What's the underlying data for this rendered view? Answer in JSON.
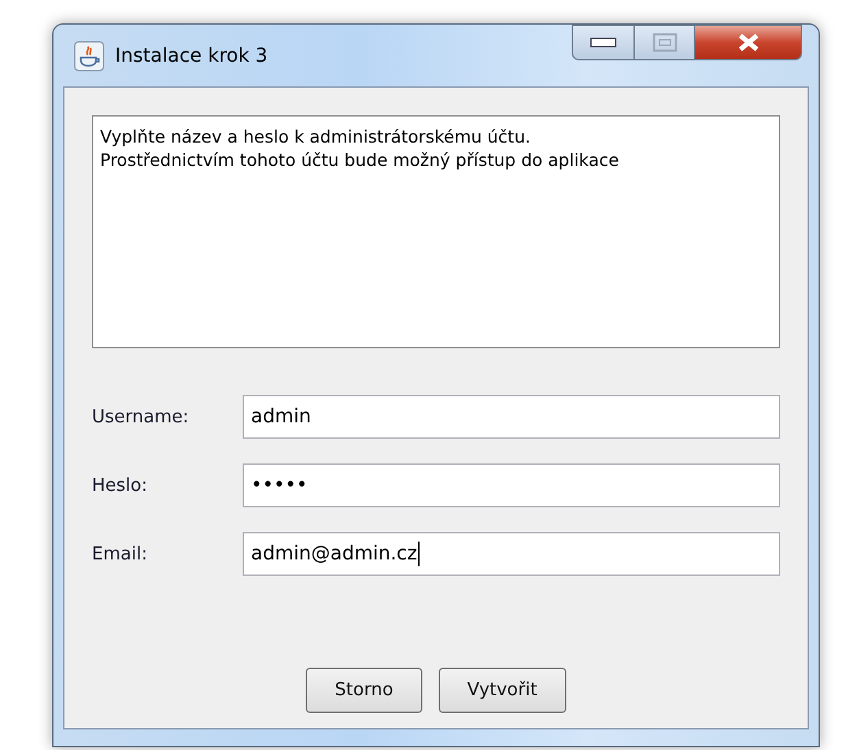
{
  "window": {
    "title": "Instalace krok 3"
  },
  "description": {
    "lines": [
      "Vyplňte název a heslo k administrátorskému účtu.",
      "Prostřednictvím tohoto účtu bude možný přístup do aplikace"
    ]
  },
  "fields": [
    {
      "label": "Username:",
      "value": "admin",
      "focused": false
    },
    {
      "label": "Heslo:",
      "value": "•••••",
      "focused": false
    },
    {
      "label": "Email:",
      "value": "admin@admin.cz",
      "focused": true
    }
  ],
  "buttons": [
    "Storno",
    "Vytvořit"
  ]
}
